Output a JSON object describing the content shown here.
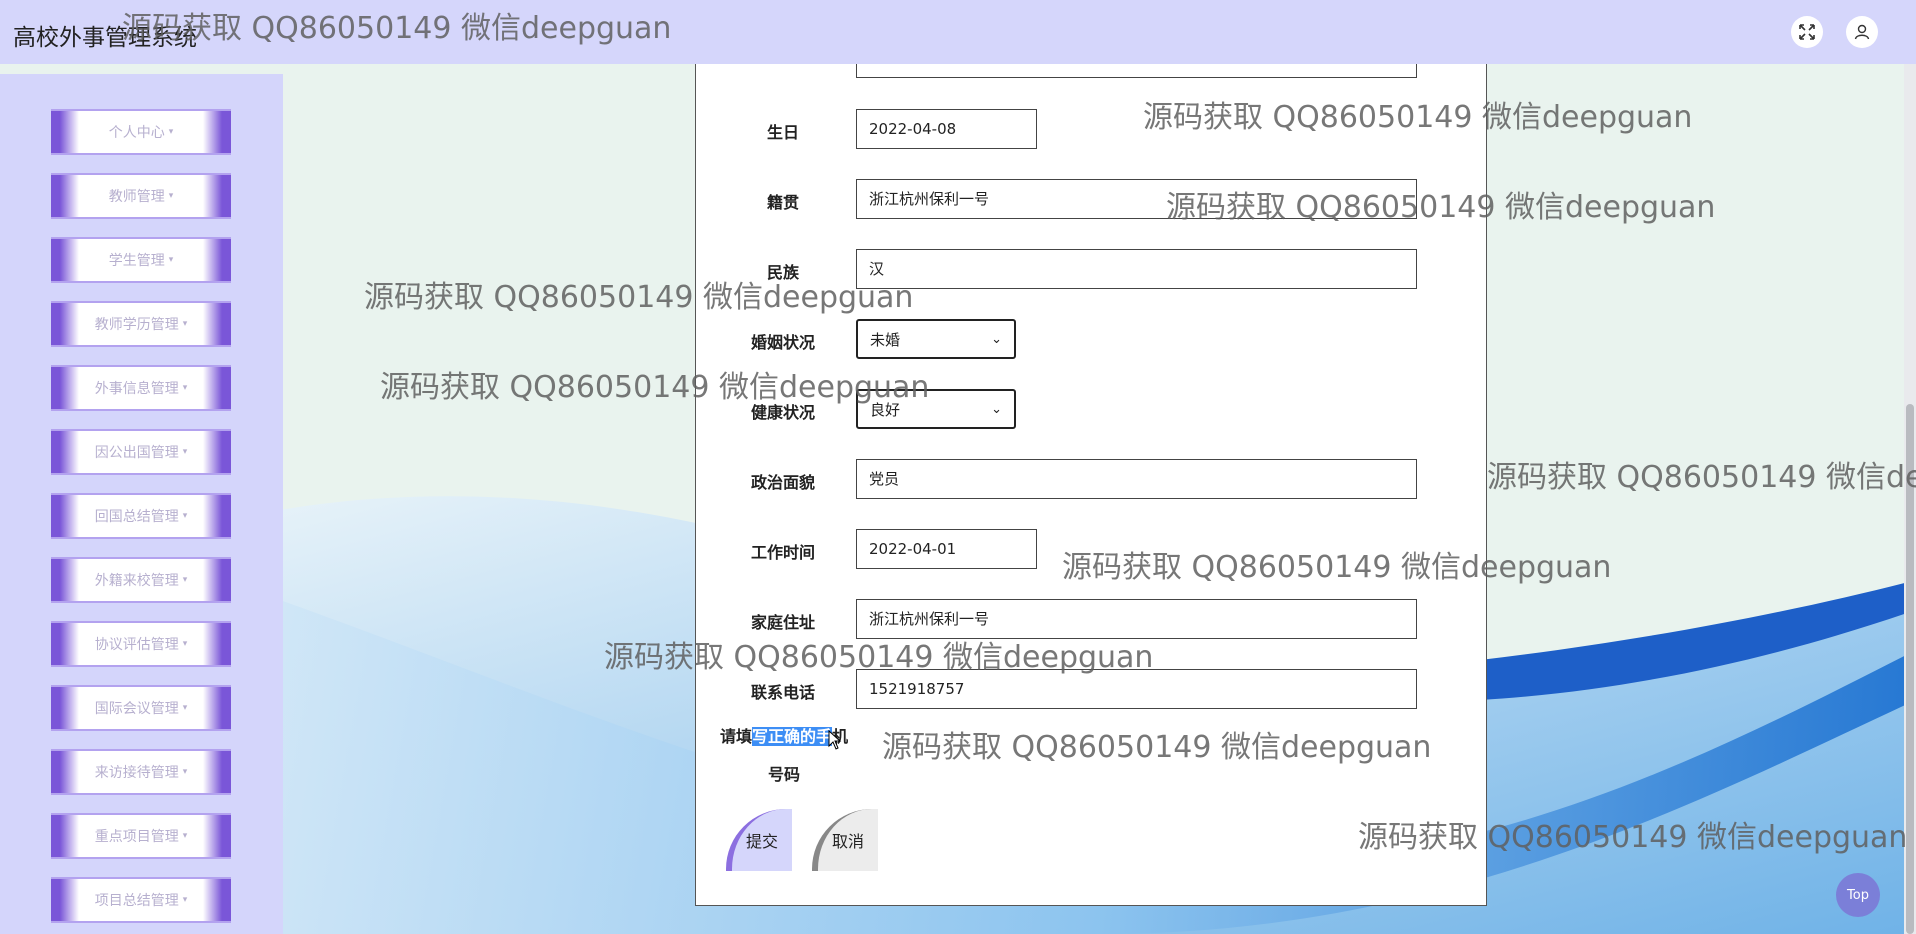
{
  "header": {
    "title": "高校外事管理系统",
    "fullscreen_icon": "fullscreen-icon",
    "user_icon": "user-icon"
  },
  "sidebar": {
    "items": [
      {
        "label": "个人中心"
      },
      {
        "label": "教师管理"
      },
      {
        "label": "学生管理"
      },
      {
        "label": "教师学历管理"
      },
      {
        "label": "外事信息管理"
      },
      {
        "label": "因公出国管理"
      },
      {
        "label": "回国总结管理"
      },
      {
        "label": "外籍来校管理"
      },
      {
        "label": "协议评估管理"
      },
      {
        "label": "国际会议管理"
      },
      {
        "label": "来访接待管理"
      },
      {
        "label": "重点项目管理"
      },
      {
        "label": "项目总结管理"
      }
    ],
    "caret": "▾"
  },
  "form": {
    "birthday": {
      "label": "生日",
      "value": "2022-04-08"
    },
    "native_place": {
      "label": "籍贯",
      "value": "浙江杭州保利一号"
    },
    "ethnicity": {
      "label": "民族",
      "value": "汉"
    },
    "marital": {
      "label": "婚姻状况",
      "value": "未婚"
    },
    "health": {
      "label": "健康状况",
      "value": "良好"
    },
    "political": {
      "label": "政治面貌",
      "value": "党员"
    },
    "work_time": {
      "label": "工作时间",
      "value": "2022-04-01"
    },
    "address": {
      "label": "家庭住址",
      "value": "浙江杭州保利一号"
    },
    "phone": {
      "label": "联系电话",
      "value": "1521918757"
    },
    "phone_error": {
      "pre": "请填",
      "highlight": "写正确的手",
      "post": "机",
      "line2": "号码"
    },
    "submit_label": "提交",
    "cancel_label": "取消"
  },
  "watermark": "源码获取 QQ86050149 微信deepguan",
  "top_button": "Top",
  "colors": {
    "header_bg": "#d5d6fb",
    "sidebar_bg": "#d4d5fb",
    "menu_accent": "#7a56d8",
    "highlight": "#3d8ef5",
    "top_button": "#7b7fd8"
  }
}
